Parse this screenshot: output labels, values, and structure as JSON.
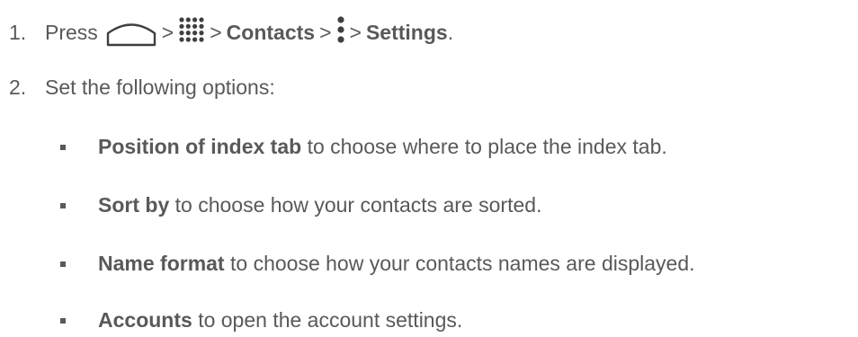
{
  "step1": {
    "number": "1.",
    "prefix": "Press",
    "separator": ">",
    "contacts": "Contacts",
    "settings": "Settings",
    "period": "."
  },
  "step2": {
    "number": "2.",
    "text": "Set the following options:"
  },
  "options": [
    {
      "term": "Position of index tab",
      "desc": "to choose where to place the index tab."
    },
    {
      "term": "Sort by",
      "desc": "to choose how your contacts are sorted."
    },
    {
      "term": "Name format",
      "desc": "to choose how your contacts names are displayed."
    },
    {
      "term": "Accounts",
      "desc": "to open the account settings."
    }
  ],
  "icons": {
    "home": "home-icon",
    "apps": "apps-grid-icon",
    "menu": "overflow-menu-icon"
  },
  "colors": {
    "text": "#595959",
    "icon": "#3f3f3f"
  }
}
